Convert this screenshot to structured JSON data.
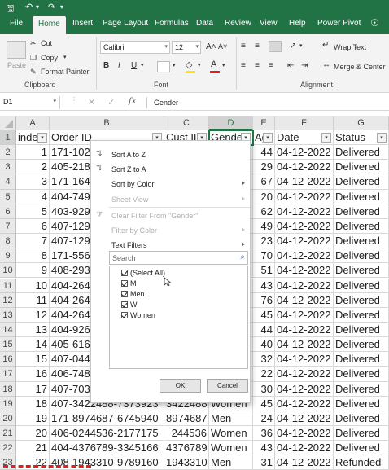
{
  "ribbon_tabs": [
    "File",
    "Home",
    "Insert",
    "Page Layout",
    "Formulas",
    "Data",
    "Review",
    "View",
    "Help",
    "Power Pivot"
  ],
  "active_tab": "Home",
  "clipboard": {
    "cut": "Cut",
    "copy": "Copy",
    "paste": "Paste",
    "format_painter": "Format Painter",
    "group": "Clipboard"
  },
  "font": {
    "name": "Calibri",
    "size": "12",
    "group": "Font"
  },
  "alignment": {
    "wrap_text": "Wrap Text",
    "merge": "Merge & Center",
    "group": "Alignment"
  },
  "formula_bar": {
    "cell_ref": "D1",
    "fx": "fx",
    "value": "Gender"
  },
  "columns": [
    "A",
    "B",
    "C",
    "D",
    "E",
    "F",
    "G"
  ],
  "header_row": [
    "inde",
    "Order ID",
    "Cust ID",
    "Gende",
    "Ag",
    "Date",
    "Status"
  ],
  "rows": [
    {
      "n": "2",
      "a": "1",
      "b": "171-102",
      "c": "",
      "d": "",
      "e": "44",
      "f": "04-12-2022",
      "g": "Delivered"
    },
    {
      "n": "3",
      "a": "2",
      "b": "405-218",
      "c": "",
      "d": "",
      "e": "29",
      "f": "04-12-2022",
      "g": "Delivered"
    },
    {
      "n": "4",
      "a": "3",
      "b": "171-164",
      "c": "",
      "d": "",
      "e": "67",
      "f": "04-12-2022",
      "g": "Delivered"
    },
    {
      "n": "5",
      "a": "4",
      "b": "404-749",
      "c": "",
      "d": "",
      "e": "20",
      "f": "04-12-2022",
      "g": "Delivered"
    },
    {
      "n": "6",
      "a": "5",
      "b": "403-929",
      "c": "",
      "d": "",
      "e": "62",
      "f": "04-12-2022",
      "g": "Delivered"
    },
    {
      "n": "7",
      "a": "6",
      "b": "407-129",
      "c": "",
      "d": "",
      "e": "49",
      "f": "04-12-2022",
      "g": "Delivered"
    },
    {
      "n": "8",
      "a": "7",
      "b": "407-129",
      "c": "",
      "d": "",
      "e": "23",
      "f": "04-12-2022",
      "g": "Delivered"
    },
    {
      "n": "9",
      "a": "8",
      "b": "171-556",
      "c": "",
      "d": "",
      "e": "70",
      "f": "04-12-2022",
      "g": "Delivered"
    },
    {
      "n": "10",
      "a": "9",
      "b": "408-293",
      "c": "",
      "d": "",
      "e": "51",
      "f": "04-12-2022",
      "g": "Delivered"
    },
    {
      "n": "11",
      "a": "10",
      "b": "404-264",
      "c": "",
      "d": "",
      "e": "43",
      "f": "04-12-2022",
      "g": "Delivered"
    },
    {
      "n": "12",
      "a": "11",
      "b": "404-264",
      "c": "",
      "d": "",
      "e": "76",
      "f": "04-12-2022",
      "g": "Delivered"
    },
    {
      "n": "13",
      "a": "12",
      "b": "404-264",
      "c": "",
      "d": "",
      "e": "45",
      "f": "04-12-2022",
      "g": "Delivered"
    },
    {
      "n": "14",
      "a": "13",
      "b": "404-926",
      "c": "",
      "d": "",
      "e": "44",
      "f": "04-12-2022",
      "g": "Delivered"
    },
    {
      "n": "15",
      "a": "14",
      "b": "405-616",
      "c": "",
      "d": "",
      "e": "40",
      "f": "04-12-2022",
      "g": "Delivered"
    },
    {
      "n": "16",
      "a": "15",
      "b": "407-044",
      "c": "",
      "d": "",
      "e": "32",
      "f": "04-12-2022",
      "g": "Delivered"
    },
    {
      "n": "17",
      "a": "16",
      "b": "406-748",
      "c": "",
      "d": "",
      "e": "22",
      "f": "04-12-2022",
      "g": "Delivered"
    },
    {
      "n": "18",
      "a": "17",
      "b": "407-703",
      "c": "",
      "d": "",
      "e": "30",
      "f": "04-12-2022",
      "g": "Delivered"
    },
    {
      "n": "19",
      "a": "18",
      "b": "407-3422488-7373923",
      "c": "3422488",
      "d": "Women",
      "e": "45",
      "f": "04-12-2022",
      "g": "Delivered"
    },
    {
      "n": "20",
      "a": "19",
      "b": "171-8974687-6745940",
      "c": "8974687",
      "d": "Men",
      "e": "24",
      "f": "04-12-2022",
      "g": "Delivered"
    },
    {
      "n": "21",
      "a": "20",
      "b": "406-0244536-2177175",
      "c": "244536",
      "d": "Women",
      "e": "36",
      "f": "04-12-2022",
      "g": "Delivered"
    },
    {
      "n": "22",
      "a": "21",
      "b": "404-4376789-3345166",
      "c": "4376789",
      "d": "Women",
      "e": "43",
      "f": "04-12-2022",
      "g": "Delivered"
    },
    {
      "n": "23",
      "a": "22",
      "b": "408-1943310-9789160",
      "c": "1943310",
      "d": "Men",
      "e": "31",
      "f": "04-12-2022",
      "g": "Refunded"
    }
  ],
  "filter_menu": {
    "sort_az": "Sort A to Z",
    "sort_za": "Sort Z to A",
    "sort_color": "Sort by Color",
    "sheet_view": "Sheet View",
    "clear_filter": "Clear Filter From \"Gender\"",
    "filter_color": "Filter by Color",
    "text_filters": "Text Filters",
    "search_placeholder": "Search",
    "items": [
      "(Select All)",
      "M",
      "Men",
      "W",
      "Women"
    ],
    "ok": "OK",
    "cancel": "Cancel"
  },
  "accent_color": "#217346"
}
